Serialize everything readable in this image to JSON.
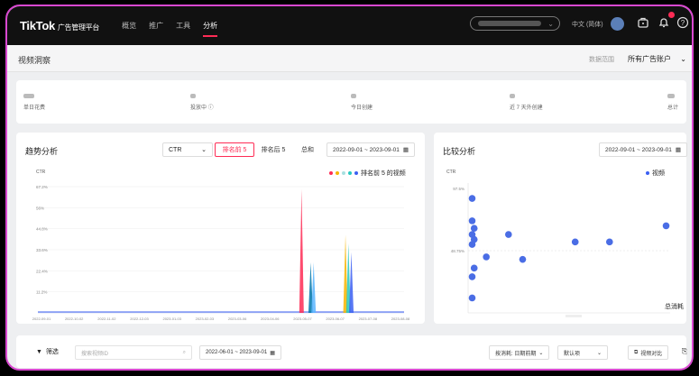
{
  "header": {
    "logo": "TikTok",
    "logo_sub": "广告管理平台",
    "nav": [
      "概览",
      "推广",
      "工具",
      "分析"
    ],
    "active_nav": "分析",
    "account_select_placeholder": "",
    "language": "中文 (简体)",
    "icons": [
      "avatar",
      "briefcase-icon",
      "bell-icon",
      "help-icon"
    ]
  },
  "page": {
    "title": "视频洞察",
    "range_label": "数据范围",
    "range_value": "所有广告账户"
  },
  "stats": [
    {
      "label": "单日花费"
    },
    {
      "label": "投放中",
      "info_icon": true
    },
    {
      "label": "今日创建"
    },
    {
      "label": "近 7 天外创建"
    },
    {
      "label": "总计"
    }
  ],
  "trend": {
    "title": "趋势分析",
    "metric": "CTR",
    "segments": [
      "排名前 5",
      "排名后 5",
      "总和"
    ],
    "active_segment": "排名前 5",
    "date_range": "2022-09-01 ~ 2023-09-01",
    "legend_label": "排名前 5 的视频"
  },
  "compare": {
    "title": "比较分析",
    "date_range": "2022-09-01 ~ 2023-09-01",
    "legend_label": "视频",
    "x_label": "总消耗"
  },
  "bottom": {
    "filter_label": "筛选",
    "search_placeholder": "搜索视频ID",
    "date_range": "2022-06-01 ~ 2023-09-01",
    "sort_select": "按消耗: 日期前期",
    "sort_order": "默认项",
    "compare_btn": "视频对比"
  },
  "chart_data": [
    {
      "type": "line",
      "title": "",
      "ylabel": "CTR",
      "ylim": [
        0,
        1
      ],
      "y_ticks": [
        "11.2%",
        "22.4%",
        "33.6%",
        "44.8%",
        "56%",
        "67.2%"
      ],
      "x_ticks": [
        "2022-09-01",
        "2022-10-02",
        "2022-11-02",
        "2022-12-03",
        "2023-01-03",
        "2023-02-03",
        "2023-03-06",
        "2023-04-06",
        "2023-05-07",
        "2023-06-07",
        "2023-07-08",
        "2023-08-08"
      ],
      "spikes": [
        {
          "x": 0.72,
          "value": 0.98,
          "color": "#fe2c55"
        },
        {
          "x": 0.745,
          "value": 0.4,
          "color": "#0077aa"
        },
        {
          "x": 0.753,
          "value": 0.4,
          "color": "#5bb5ff"
        },
        {
          "x": 0.84,
          "value": 0.62,
          "color": "#f7b500"
        },
        {
          "x": 0.848,
          "value": 0.55,
          "color": "#27c9c0"
        },
        {
          "x": 0.856,
          "value": 0.48,
          "color": "#3b5ff2"
        }
      ],
      "legend_colors": [
        "#fe2c55",
        "#f7b500",
        "#a8e0e0",
        "#27c9c0",
        "#3b5ff2"
      ]
    },
    {
      "type": "scatter",
      "title": "",
      "ylabel": "CTR",
      "xlabel": "总消耗",
      "y_ticks": [
        "97.5%",
        "48.75%"
      ],
      "points": [
        [
          0.02,
          0.92
        ],
        [
          0.02,
          0.74
        ],
        [
          0.03,
          0.68
        ],
        [
          0.02,
          0.63
        ],
        [
          0.03,
          0.59
        ],
        [
          0.02,
          0.55
        ],
        [
          0.2,
          0.63
        ],
        [
          0.09,
          0.45
        ],
        [
          0.03,
          0.36
        ],
        [
          0.02,
          0.29
        ],
        [
          0.27,
          0.43
        ],
        [
          0.53,
          0.57
        ],
        [
          0.7,
          0.57
        ],
        [
          0.02,
          0.12
        ],
        [
          0.98,
          0.7
        ]
      ]
    }
  ]
}
